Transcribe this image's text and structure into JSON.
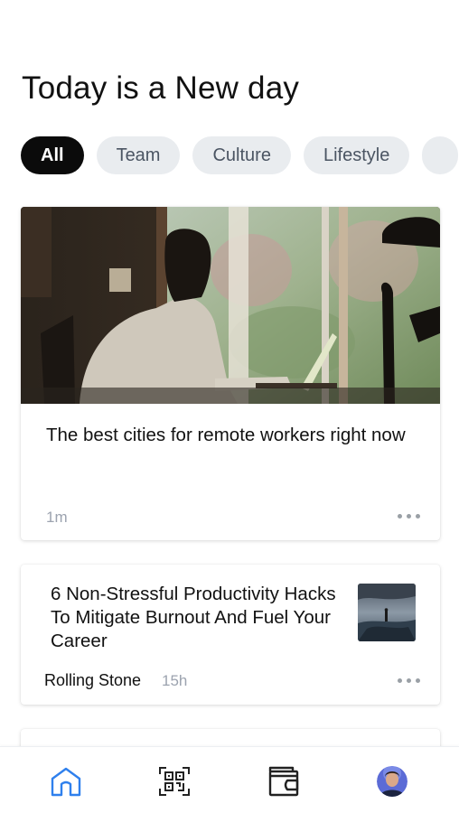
{
  "header": {
    "title": "Today is a New day"
  },
  "filters": [
    {
      "label": "All",
      "active": true
    },
    {
      "label": "Team",
      "active": false
    },
    {
      "label": "Culture",
      "active": false
    },
    {
      "label": "Lifestyle",
      "active": false
    }
  ],
  "feature": {
    "title": "The best cities for remote workers right now",
    "time": "1m",
    "image": "person-at-laptop-by-window-photo"
  },
  "article": {
    "title": "6 Non-Stressful Productivity Hacks To Mitigate Burnout And Fuel Your Career",
    "source": "Rolling Stone",
    "time": "15h",
    "image": "person-on-rock-by-sea-photo"
  },
  "nav": {
    "items": [
      "home-icon",
      "qr-scan-icon",
      "wallet-icon",
      "profile-avatar"
    ],
    "active": "home-icon",
    "active_color": "#2f80ed"
  },
  "colors": {
    "chip_active_bg": "#0b0b0b",
    "chip_bg": "#e9ecef",
    "meta_text": "#9ca3af"
  }
}
